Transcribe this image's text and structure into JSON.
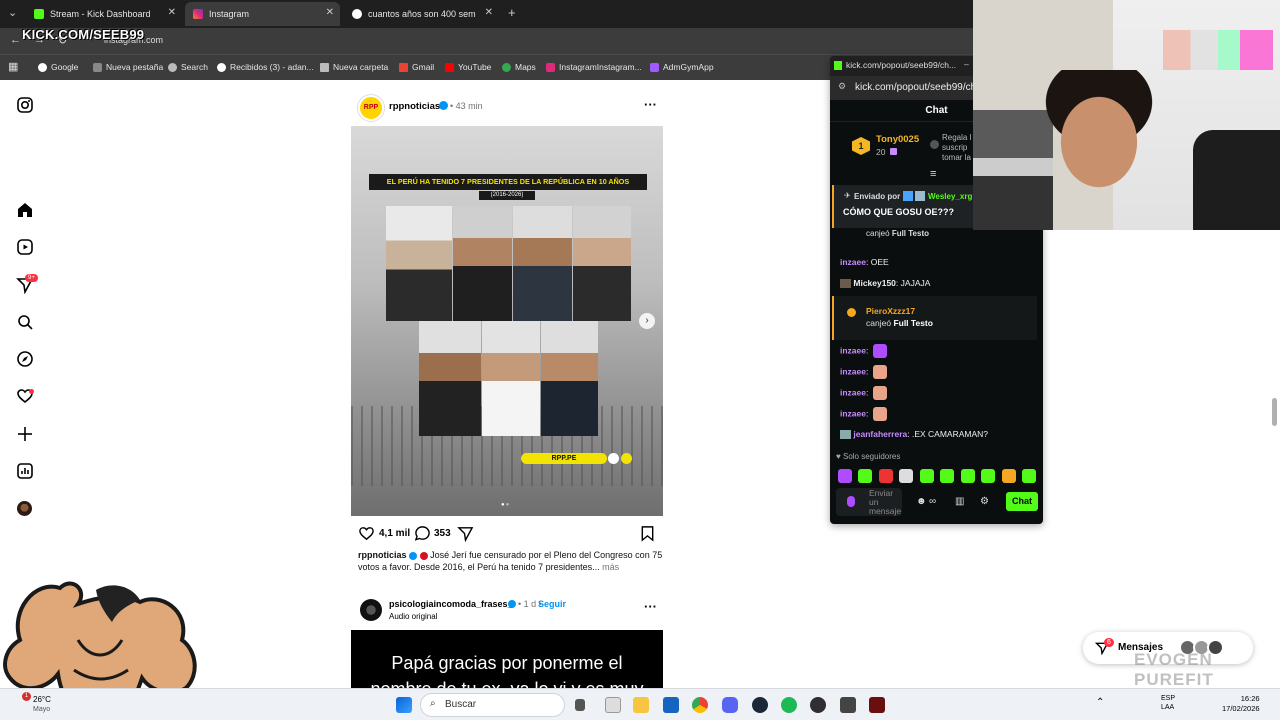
{
  "colors": {
    "kick_green": "#53fc18",
    "instagram_blue": "#0095f6",
    "chat_bg": "#0b0e0f",
    "notification_red": "#ff3040"
  },
  "browser": {
    "tabs": [
      {
        "title": "Stream - Kick Dashboard",
        "icon": "kick-icon",
        "active": false
      },
      {
        "title": "Instagram",
        "icon": "instagram-icon",
        "active": true
      },
      {
        "title": "cuantos años son 400 semanas",
        "icon": "google-icon",
        "active": false
      }
    ],
    "new_tab": "+",
    "url": "instagram.com",
    "stream_overlay": "KICK.COM/SEEB99",
    "bookmarks": [
      "Google",
      "Nueva pestaña",
      "Search",
      "Recibidos (3) - adan...",
      "Nueva carpeta",
      "Gmail",
      "YouTube",
      "Maps",
      "InstagramInstagram...",
      "AdmGymApp"
    ]
  },
  "instagram": {
    "nav_icons": [
      "instagram-logo-icon",
      "home-icon",
      "reels-icon",
      "messages-icon",
      "search-icon",
      "explore-icon",
      "notifications-icon",
      "create-icon",
      "dashboard-icon",
      "profile-icon",
      "more-icon"
    ],
    "messages_badge": "9+",
    "post": {
      "username": "rppnoticias",
      "avatar_text": "RPP",
      "time": "43 min",
      "image_headline": "EL PERÚ HA TENIDO 7 PRESIDENTES DE LA REPÚBLICA EN 10 AÑOS",
      "image_subheadline": "(2016-2026)",
      "image_brand": "RPP.PE",
      "likes": "4,1 mil",
      "comments": "353",
      "caption_user": "rppnoticias",
      "caption_text": "José Jerí fue censurado por el Pleno del Congreso con 75 votos a favor. Desde 2016, el Perú ha tenido 7 presidentes...",
      "more": "más"
    },
    "post2": {
      "username": "psicologiaincomoda_frases_",
      "time": "1 d",
      "follow": "Seguir",
      "audio": "Audio original",
      "image_text_line1": "Papá gracias por ponerme el",
      "image_text_line2": "nombre de tu ex, ya lo vi y es muy"
    },
    "messages_button": "Mensajes",
    "messages_count": "6"
  },
  "chat": {
    "window_title": "kick.com/popout/seeb99/ch...",
    "url": "kick.com/popout/seeb99/cha",
    "header": "Chat",
    "top_gifter": {
      "rank": "1",
      "name": "Tony0025",
      "amount": "20"
    },
    "gift_text": "Regala l\nsuscrip\ntomar la",
    "pinned_label": "Enviado por",
    "pinned_user": "Wesley_xrg",
    "pinned_text": "CÓMO QUE GOSU OE???",
    "redeem_partial": "canjeó",
    "redeem_partial_item": "Full Testo",
    "messages": [
      {
        "user": "inzaee",
        "text": "OEE",
        "color": "#c78bff"
      },
      {
        "user": "Mickey150",
        "text": "JAJAJA",
        "color": "#ffffff"
      }
    ],
    "redeem": {
      "user": "PieroXzzz17",
      "action": "canjeó",
      "item": "Full Testo"
    },
    "emote_messages": [
      {
        "user": "inzaee",
        "emote": "butterfly-emote"
      },
      {
        "user": "inzaee",
        "emote": "face-emote"
      },
      {
        "user": "inzaee",
        "emote": "face-emote"
      },
      {
        "user": "inzaee",
        "emote": "face-emote"
      }
    ],
    "last_message": {
      "user": "jeanfaherrera",
      "text": ".EX CAMARAMAN?"
    },
    "followers_only": "Solo seguidores",
    "input_placeholder": "Enviar un mensaje",
    "send": "Chat"
  },
  "taskbar": {
    "weather_temp": "26°C",
    "weather_desc": "Mayo",
    "weather_alert": "1",
    "search": "Buscar",
    "lang": "ESP",
    "lang2": "LAA",
    "time": "16:26",
    "date": "17/02/2026"
  },
  "watermark": "EVOGEN PUREFIT"
}
